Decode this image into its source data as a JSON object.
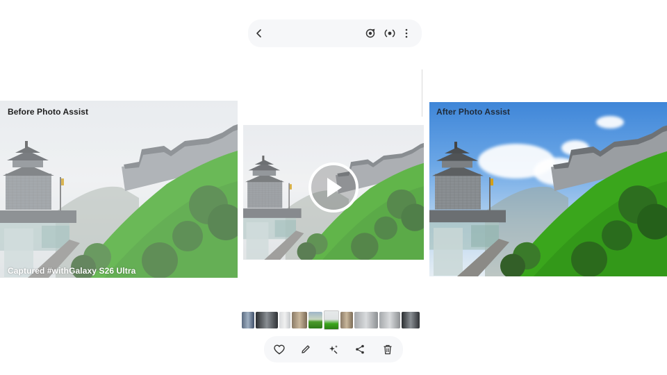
{
  "before": {
    "caption": "Before Photo Assist",
    "watermark": "Captured #withGalaxy S26 Ultra"
  },
  "after": {
    "caption": "After Photo Assist"
  },
  "viewer": {
    "top_icons": [
      "back-icon",
      "remaster-icon",
      "motion-photo-icon",
      "more-options-icon"
    ],
    "bottom_icons": [
      "favorite-icon",
      "edit-icon",
      "magic-assist-icon",
      "share-icon",
      "delete-icon"
    ],
    "video_state": "paused",
    "thumbnails": [
      {
        "name": "thumb-1",
        "kind": "indoor"
      },
      {
        "name": "thumb-2",
        "kind": "dark"
      },
      {
        "name": "thumb-3",
        "kind": "light"
      },
      {
        "name": "thumb-4",
        "kind": "room"
      },
      {
        "name": "thumb-5",
        "kind": "green"
      },
      {
        "name": "thumb-6",
        "kind": "current"
      },
      {
        "name": "thumb-7",
        "kind": "room"
      },
      {
        "name": "thumb-8",
        "kind": "grey"
      },
      {
        "name": "thumb-9",
        "kind": "grey"
      },
      {
        "name": "thumb-10",
        "kind": "dark"
      }
    ]
  },
  "colors": {
    "grass": "#3aa61c",
    "sky_after": "#3f86d8",
    "fog": "#eceff1"
  }
}
